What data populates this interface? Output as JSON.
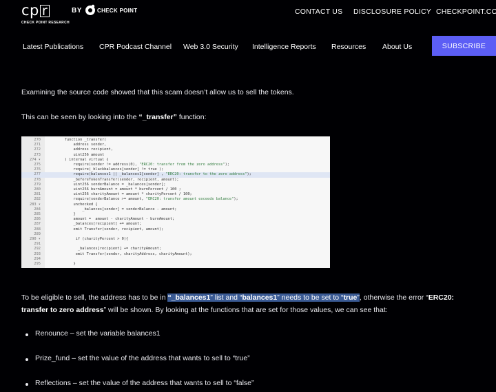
{
  "header": {
    "logo_text": "cp<r>",
    "logo_sub": "CHECK POINT RESEARCH",
    "by": "BY",
    "brand": "CHECK POINT",
    "links": [
      "CONTACT US",
      "DISCLOSURE POLICY",
      "CHECKPOINT.COM"
    ]
  },
  "nav": {
    "items": [
      "Latest Publications",
      "CPR Podcast Channel",
      "Web 3.0 Security",
      "Intelligence Reports",
      "Resources",
      "About Us"
    ],
    "subscribe": "SUBSCRIBE"
  },
  "article": {
    "p1": "Examining the source code showed that this scam doesn’t allow us to sell the tokens.",
    "p2_pre": "This can be seen by looking into the ",
    "p2_bold": "“_transfer”",
    "p2_post": " function:",
    "p3_a": "To be eligible to sell, the address has to be in ",
    "p3_sel_1": "“_balances1",
    "p3_sel_2": "” list and “",
    "p3_sel_3": "balances1",
    "p3_sel_4": "” needs to be set to “",
    "p3_sel_5": "true",
    "p3_sel_6": "”",
    "p3_b": ", otherwise the error “",
    "p3_bold1": "ERC20:",
    "p3_bold2": "transfer to zero address",
    "p3_c": "” will be shown. By looking at the functions that are set for those values, we can see that:",
    "bullets": [
      "Renounce – set the variable balances1",
      "Prize_fund – set the value of the address that wants to sell to “true”",
      "Reflections – set the value of the address that wants to sell to “false”"
    ]
  },
  "code": [
    {
      "ln": "270",
      "text": "    function _transfer("
    },
    {
      "ln": "271",
      "text": "        address sender,"
    },
    {
      "ln": "272",
      "text": "        address recipient,"
    },
    {
      "ln": "273",
      "text": "        uint256 amount"
    },
    {
      "ln": "274 ▾",
      "text": "    ) internal virtual {"
    },
    {
      "ln": "275",
      "text": "        require(sender != address(0), \"ERC20: transfer from the zero address\");"
    },
    {
      "ln": "276",
      "text": "        require(_blackbalances[sender] != true );"
    },
    {
      "ln": "277",
      "text": "        require(balances1 || _balances1[sender] , \"ERC20: transfer to the zero address\");",
      "highlight": true
    },
    {
      "ln": "278",
      "text": "        _beforeTokenTransfer(sender, recipient, amount);"
    },
    {
      "ln": "279",
      "text": "        uint256 senderBalance = _balances[sender];"
    },
    {
      "ln": "280",
      "text": "        uint256 burnAmount = amount * burnPercent / 100 ;"
    },
    {
      "ln": "281",
      "text": "        uint256 charityAmount = amount * charityPercent / 100;"
    },
    {
      "ln": "282",
      "text": "        require(senderBalance >= amount, \"ERC20: transfer amount exceeds balance\");"
    },
    {
      "ln": "283 ▾",
      "text": "        unchecked {"
    },
    {
      "ln": "284",
      "text": "            _balances[sender] = senderBalance - amount;"
    },
    {
      "ln": "285",
      "text": "        }"
    },
    {
      "ln": "286",
      "text": "        amount =  amount - charityAmount - burnAmount;"
    },
    {
      "ln": "287",
      "text": "        _balances[recipient] += amount;"
    },
    {
      "ln": "288",
      "text": "        emit Transfer(sender, recipient, amount);"
    },
    {
      "ln": "289",
      "text": ""
    },
    {
      "ln": "290 ▾",
      "text": "         if (charityPercent > 0){"
    },
    {
      "ln": "291",
      "text": ""
    },
    {
      "ln": "292",
      "text": "          _balances[recipient] += charityAmount;"
    },
    {
      "ln": "293",
      "text": "         emit Transfer(sender, charityAddress, charityAmount);"
    },
    {
      "ln": "294",
      "text": ""
    },
    {
      "ln": "295",
      "text": "        }"
    }
  ]
}
